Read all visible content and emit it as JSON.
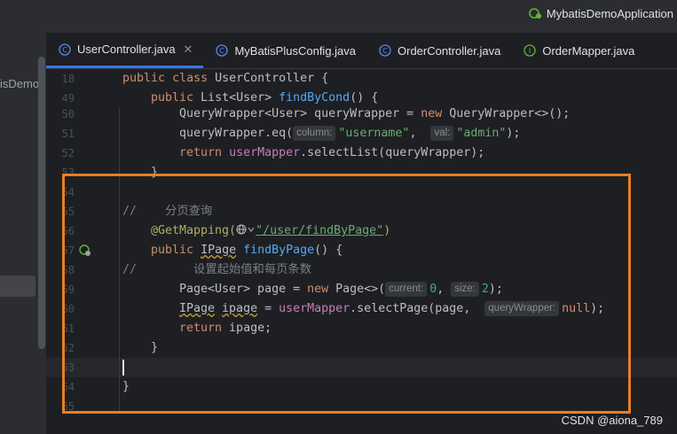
{
  "window": {
    "run_configuration": "MybatisDemoApplication"
  },
  "project_panel": {
    "label": "isDemo"
  },
  "tabs": [
    {
      "label": "UserController.java",
      "active": true,
      "icon": "class-icon"
    },
    {
      "label": "MyBatisPlusConfig.java",
      "active": false,
      "icon": "class-icon"
    },
    {
      "label": "OrderController.java",
      "active": false,
      "icon": "class-icon"
    },
    {
      "label": "OrderMapper.java",
      "active": false,
      "icon": "interface-icon"
    }
  ],
  "line_numbers": [
    "18",
    "49",
    "50",
    "51",
    "52",
    "53",
    "54",
    "55",
    "56",
    "57",
    "58",
    "59",
    "60",
    "61",
    "62",
    "63",
    "64",
    "65"
  ],
  "code": {
    "l18": {
      "kw1": "public",
      "kw2": "class",
      "name": " UserController {"
    },
    "l49": {
      "kw1": "public",
      "type": " List<User> ",
      "fn": "findByCond",
      "rest": "() {"
    },
    "l50": {
      "a": "QueryWrapper<User> queryWrapper = ",
      "kw": "new",
      "b": " QueryWrapper<>();"
    },
    "l51": {
      "a": "queryWrapper.eq(",
      "hint1": "column:",
      "s1": "\"username\"",
      "c": ",  ",
      "hint2": "val:",
      "s2": "\"admin\"",
      "d": ");"
    },
    "l52": {
      "kw": "return",
      "fld": "userMapper",
      "rest": ".selectList(queryWrapper);"
    },
    "l53": {
      "text": "}"
    },
    "l55": {
      "text": "//    分页查询"
    },
    "l56": {
      "ann": "@GetMapping(",
      "str": "\"/user/findByPage\"",
      "rest": ")"
    },
    "l57": {
      "kw": "public",
      "type": "IPage",
      "fn": "findByPage",
      "rest": "() {"
    },
    "l58": {
      "text": "//        设置起始值和每页条数"
    },
    "l59": {
      "a": "Page<User> page = ",
      "kw": "new",
      "b": " Page<>(",
      "hint1": "current:",
      "n1": "0",
      "c": ", ",
      "hint2": "size:",
      "n2": "2",
      "d": ");"
    },
    "l60": {
      "type": "IPage",
      "var": "ipage",
      "eq": " = ",
      "fld": "userMapper",
      "a": ".selectPage(page,  ",
      "hint": "queryWrapper:",
      "kw": "null",
      "d": ");"
    },
    "l61": {
      "kw": "return",
      "rest": " ipage;"
    },
    "l62": {
      "text": "}"
    },
    "l64": {
      "text": "}"
    }
  },
  "watermark": "CSDN @aiona_789",
  "colors": {
    "highlight": "#e97e25",
    "accent": "#3574f0",
    "background": "#1e1f22"
  }
}
